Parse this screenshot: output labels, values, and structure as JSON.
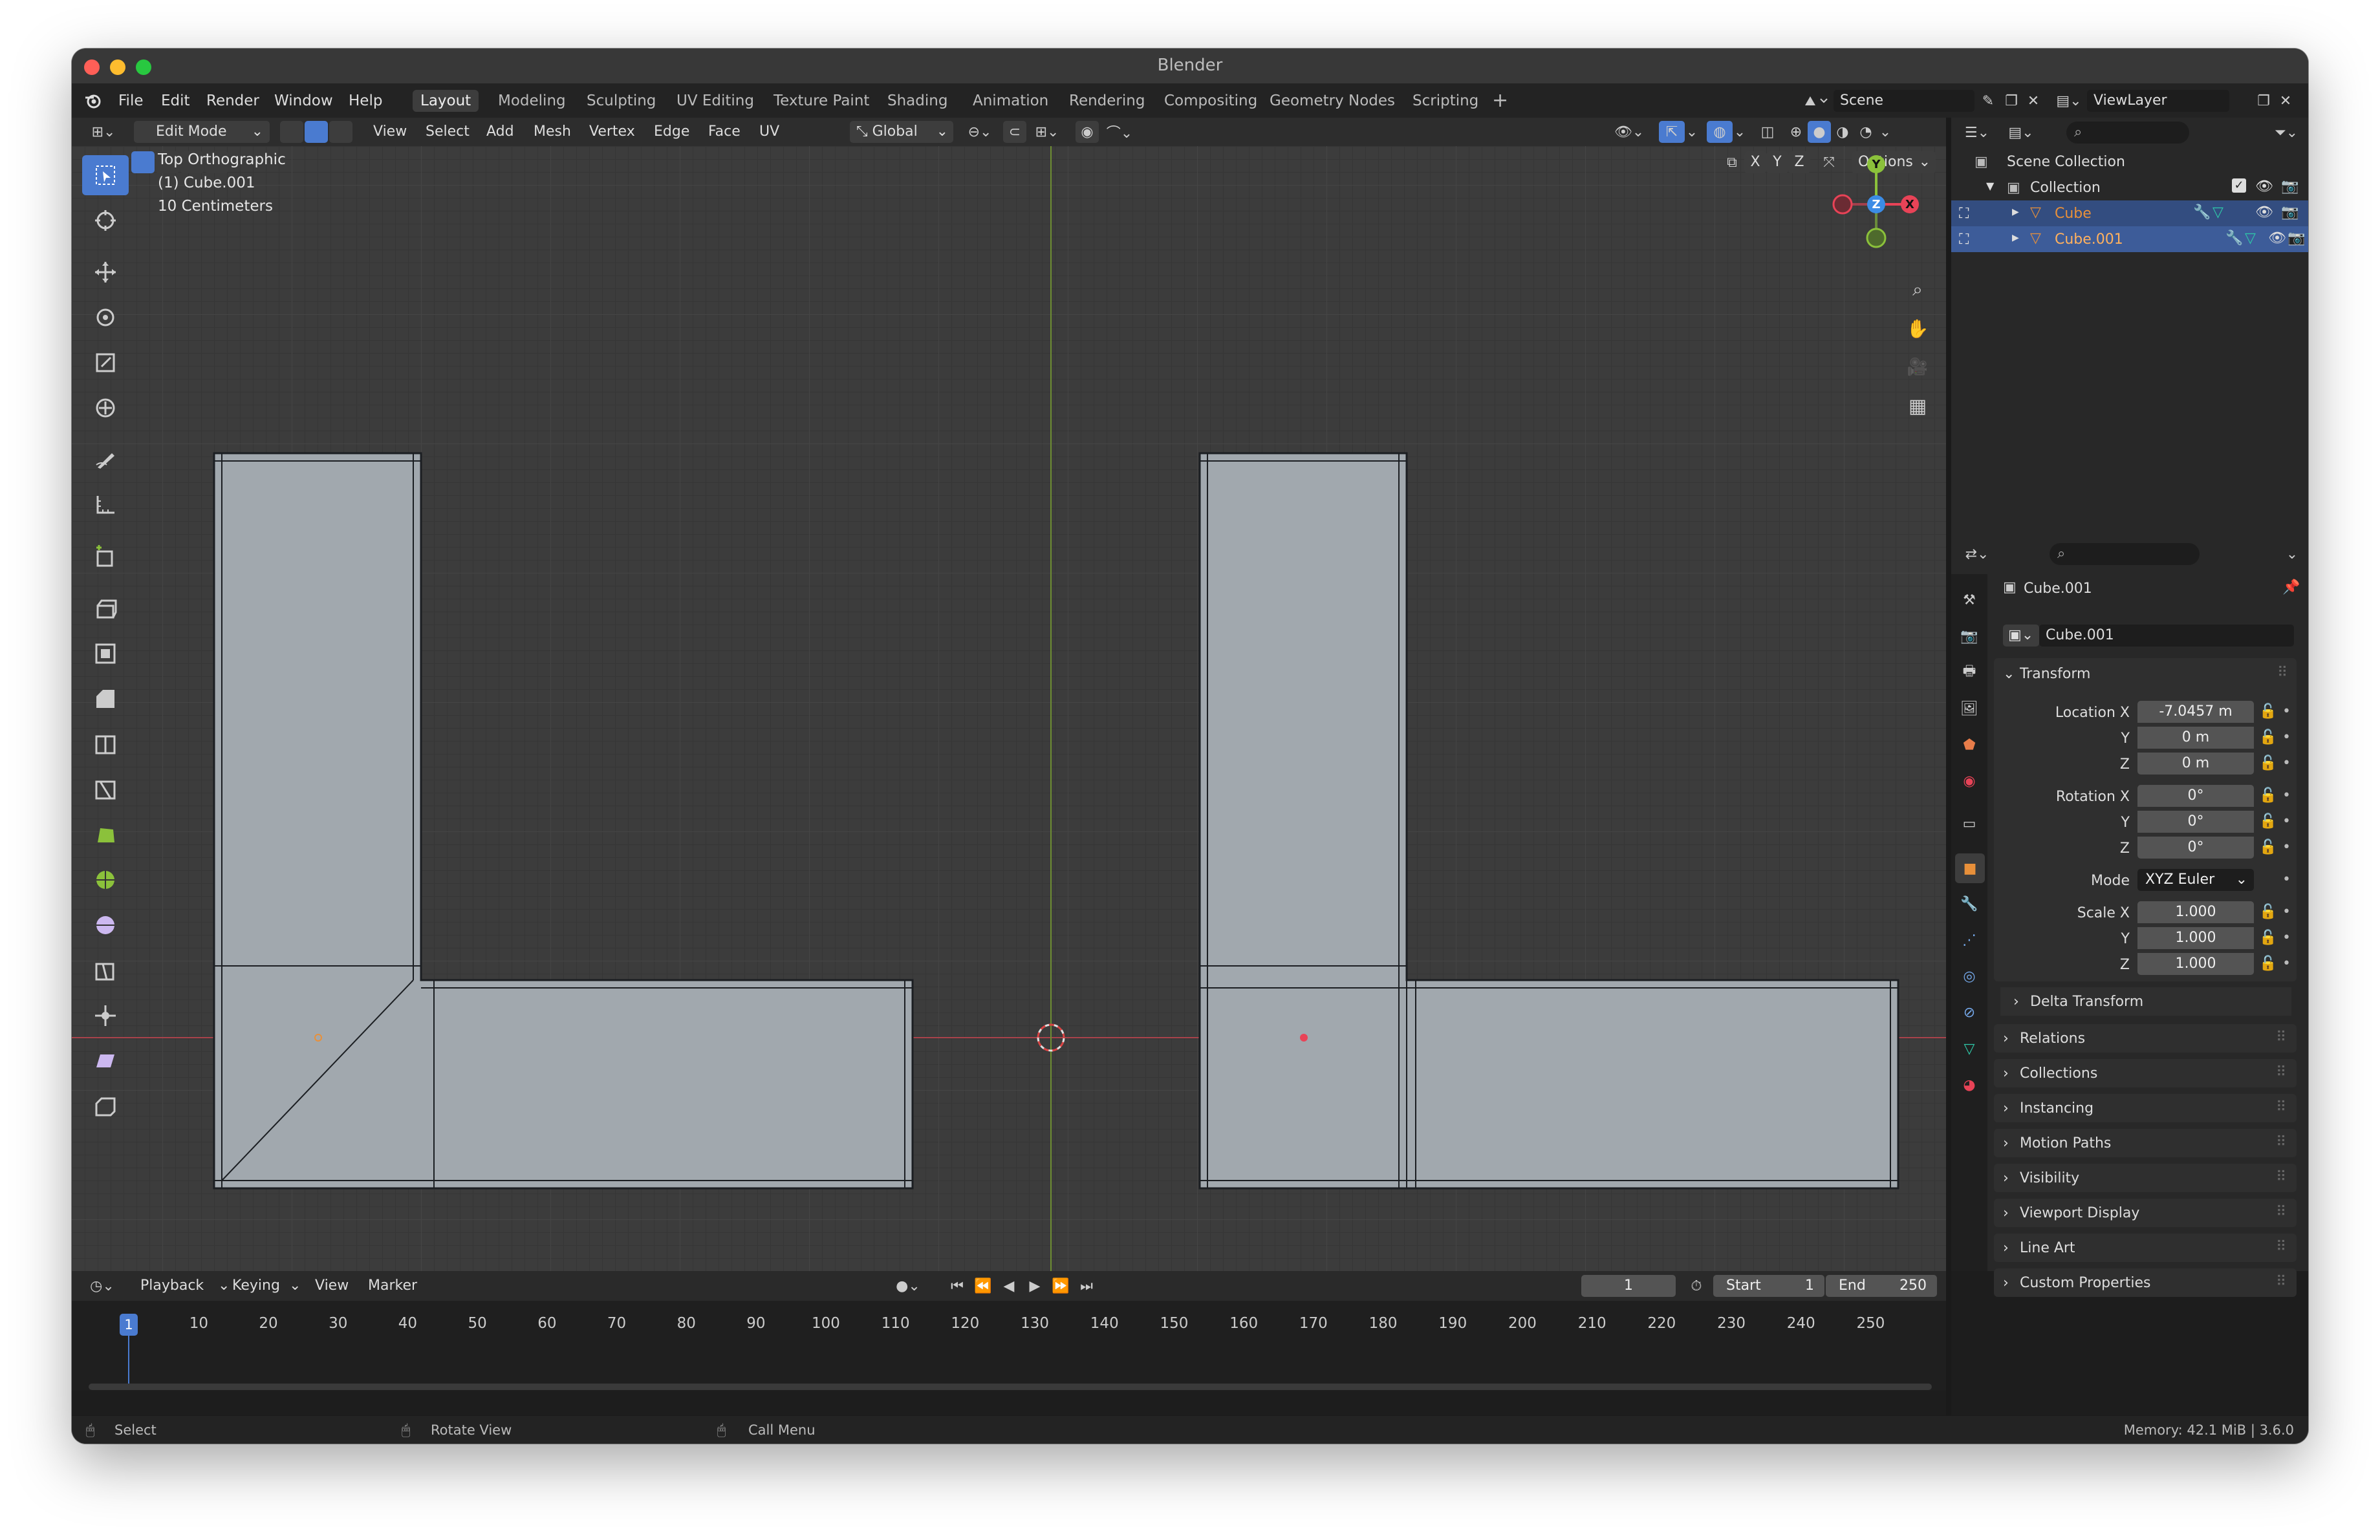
{
  "window": {
    "title": "Blender"
  },
  "menu": [
    "File",
    "Edit",
    "Render",
    "Window",
    "Help"
  ],
  "workspaces": [
    "Layout",
    "Modeling",
    "Sculpting",
    "UV Editing",
    "Texture Paint",
    "Shading",
    "Animation",
    "Rendering",
    "Compositing",
    "Geometry Nodes",
    "Scripting"
  ],
  "scene": {
    "name": "Scene",
    "view_layer": "ViewLayer"
  },
  "viewport_header": {
    "mode": "Edit Mode",
    "menus": [
      "View",
      "Select",
      "Add",
      "Mesh",
      "Vertex",
      "Edge",
      "Face",
      "UV"
    ],
    "orientation": "Global",
    "options": "Options",
    "axes": [
      "X",
      "Y",
      "Z"
    ]
  },
  "viewport_info": {
    "view": "Top Orthographic",
    "object": "(1) Cube.001",
    "scale": "10 Centimeters"
  },
  "gizmo": {
    "y": "Y",
    "z": "Z",
    "x": "X"
  },
  "outliner": {
    "root": "Scene Collection",
    "collection": "Collection",
    "items": [
      "Cube",
      "Cube.001"
    ]
  },
  "properties": {
    "object": "Cube.001",
    "object_field": "Cube.001",
    "transform": "Transform",
    "location_label": "Location X",
    "loc_x": "-7.0457 m",
    "loc_y": "0 m",
    "loc_z": "0 m",
    "rotation_label": "Rotation X",
    "rot_x": "0°",
    "rot_y": "0°",
    "rot_z": "0°",
    "mode_label": "Mode",
    "mode": "XYZ Euler",
    "scale_label": "Scale X",
    "scale_x": "1.000",
    "scale_y": "1.000",
    "scale_z": "1.000",
    "y": "Y",
    "z": "Z",
    "delta": "Delta Transform",
    "panels": [
      "Relations",
      "Collections",
      "Instancing",
      "Motion Paths",
      "Visibility",
      "Viewport Display",
      "Line Art",
      "Custom Properties"
    ]
  },
  "timeline": {
    "menus": [
      "Playback",
      "Keying",
      "View",
      "Marker"
    ],
    "current": "1",
    "start_label": "Start",
    "start": "1",
    "end_label": "End",
    "end": "250",
    "cursor": "1",
    "ticks": [
      "10",
      "20",
      "30",
      "40",
      "50",
      "60",
      "70",
      "80",
      "90",
      "100",
      "110",
      "120",
      "130",
      "140",
      "150",
      "160",
      "170",
      "180",
      "190",
      "200",
      "210",
      "220",
      "230",
      "240",
      "250"
    ]
  },
  "status": {
    "select": "Select",
    "rotate": "Rotate View",
    "menu": "Call Menu",
    "memory": "Memory: 42.1 MiB | 3.6.0"
  },
  "colors": {
    "accent": "#4a7bd0",
    "selected_orange": "#e8903a",
    "x_axis": "#e84357",
    "y_axis": "#8bc13b",
    "z_axis": "#3b8ce6"
  }
}
